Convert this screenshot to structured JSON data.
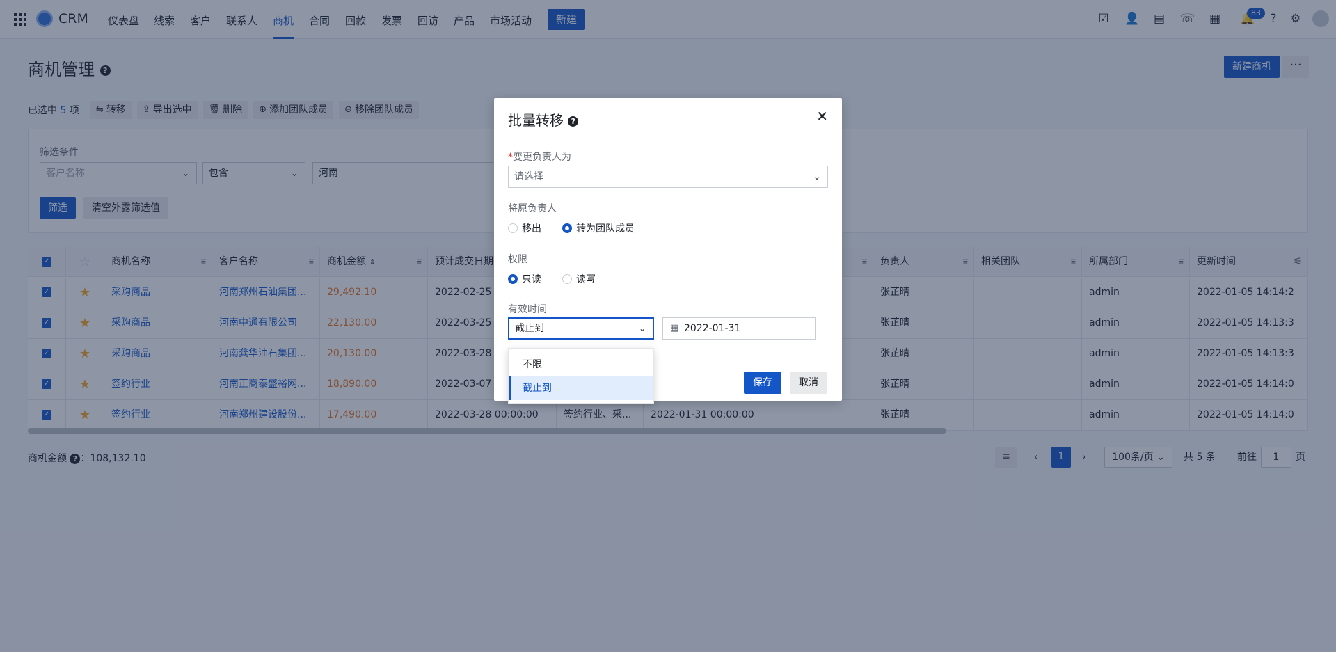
{
  "app": {
    "logo_text": "CRM"
  },
  "nav": {
    "items": [
      "仪表盘",
      "线索",
      "客户",
      "联系人",
      "商机",
      "合同",
      "回款",
      "发票",
      "回访",
      "产品",
      "市场活动"
    ],
    "active": "商机",
    "new_label": "新建",
    "notification_count": "83"
  },
  "page": {
    "title": "商机管理",
    "help": "?",
    "new_button": "新建商机",
    "more": "···"
  },
  "selection": {
    "prefix": "已选中",
    "count": "5",
    "suffix": "项",
    "actions": [
      "转移",
      "导出选中",
      "删除",
      "添加团队成员",
      "移除团队成员"
    ]
  },
  "filter": {
    "label": "筛选条件",
    "field_placeholder": "客户名称",
    "operator": "包含",
    "value": "河南",
    "apply": "筛选",
    "clear": "清空外露筛选值"
  },
  "table": {
    "headers": [
      "商机名称",
      "客户名称",
      "商机金额",
      "预计成交日期",
      "负责人",
      "相关团队",
      "所属部门",
      "更新时间"
    ],
    "rows": [
      {
        "name": "采购商品",
        "customer": "河南郑州石油集团...",
        "amount": "29,492.10",
        "date": "2022-02-25 0",
        "owner": "张芷晴",
        "dept": "admin",
        "updated": "2022-01-05 14:14:2"
      },
      {
        "name": "采购商品",
        "customer": "河南中通有限公司",
        "amount": "22,130.00",
        "date": "2022-03-25 0",
        "owner": "张芷晴",
        "dept": "admin",
        "updated": "2022-01-05 14:13:3"
      },
      {
        "name": "采购商品",
        "customer": "河南龚华油石集团...",
        "amount": "20,130.00",
        "date": "2022-03-28 0",
        "owner": "张芷晴",
        "dept": "admin",
        "updated": "2022-01-05 14:13:3"
      },
      {
        "name": "签约行业",
        "customer": "河南正商泰盛裕网...",
        "amount": "18,890.00",
        "date": "2022-03-07 0",
        "owner": "张芷晴",
        "dept": "admin",
        "updated": "2022-01-05 14:14:0"
      },
      {
        "name": "签约行业",
        "customer": "河南郑州建设股份...",
        "amount": "17,490.00",
        "date": "2022-03-28 00:00:00",
        "extra1": "签约行业、采...",
        "extra2": "2022-01-31 00:00:00",
        "owner": "张芷晴",
        "dept": "admin",
        "updated": "2022-01-05 14:14:0"
      }
    ]
  },
  "footer": {
    "sum_label": "商机金额",
    "sum_value": "：108,132.10",
    "page": "1",
    "page_size": "100条/页",
    "total": "共 5 条",
    "goto_prefix": "前往",
    "goto_value": "1",
    "goto_suffix": "页"
  },
  "modal": {
    "title": "批量转移",
    "owner_label": "变更负责人为",
    "owner_placeholder": "请选择",
    "orig_label": "将原负责人",
    "orig_options": [
      "移出",
      "转为团队成员"
    ],
    "orig_selected": "转为团队成员",
    "perm_label": "权限",
    "perm_options": [
      "只读",
      "读写"
    ],
    "perm_selected": "只读",
    "valid_label": "有效时间",
    "valid_value": "截止到",
    "date_value": "2022-01-31",
    "save": "保存",
    "cancel": "取消",
    "dropdown_options": [
      "不限",
      "截止到"
    ],
    "dropdown_selected": "截止到"
  },
  "colors": {
    "primary": "#1456c7",
    "amount": "#e8711a",
    "star": "#f5a623"
  }
}
